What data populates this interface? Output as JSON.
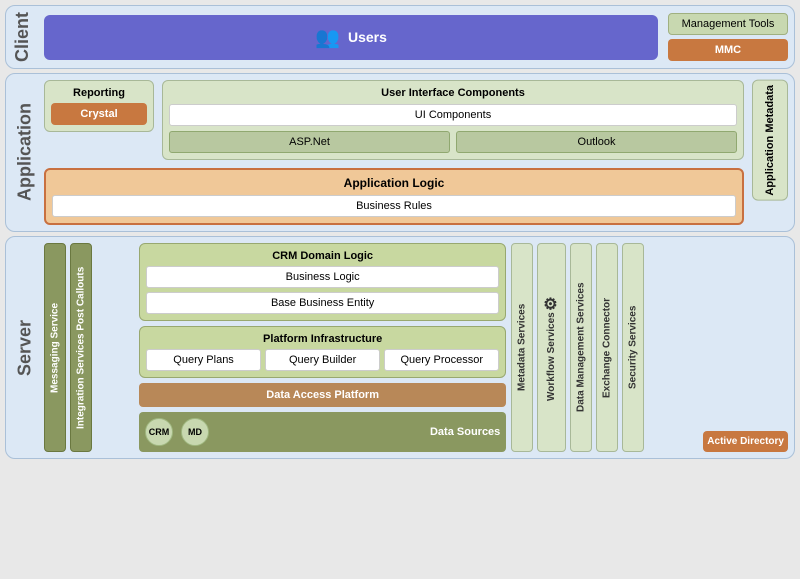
{
  "client": {
    "label": "Client",
    "users": {
      "label": "Users",
      "icon": "👥"
    },
    "management": {
      "title": "Management Tools",
      "mmc": "MMC"
    }
  },
  "application": {
    "label": "Application",
    "reporting": {
      "title": "Reporting",
      "crystal": "Crystal"
    },
    "ui_components": {
      "title": "User Interface Components",
      "ui_components": "UI Components",
      "asp_net": "ASP.Net",
      "outlook": "Outlook"
    },
    "app_logic": {
      "title": "Application Logic",
      "business_rules": "Business Rules"
    },
    "metadata": "Application Metadata"
  },
  "server": {
    "label": "Server",
    "messaging": "Messaging Service",
    "integration": "Integration Services Post Callouts",
    "crm_domain": {
      "title": "CRM Domain Logic",
      "business_logic": "Business Logic",
      "base_business": "Base Business Entity"
    },
    "platform": {
      "title": "Platform Infrastructure",
      "query_plans": "Query Plans",
      "query_builder": "Query Builder",
      "query_processor": "Query Processor"
    },
    "data_access": "Data Access Platform",
    "data_sources": {
      "title": "Data Sources",
      "crm": "CRM",
      "md": "MD"
    },
    "metadata_services": "Metadata Services",
    "workflow_services": "Workflow Services",
    "data_management": "Data Management Services",
    "exchange_connector": "Exchange Connector",
    "security_services": "Security Services",
    "active_directory": "Active Directory"
  }
}
